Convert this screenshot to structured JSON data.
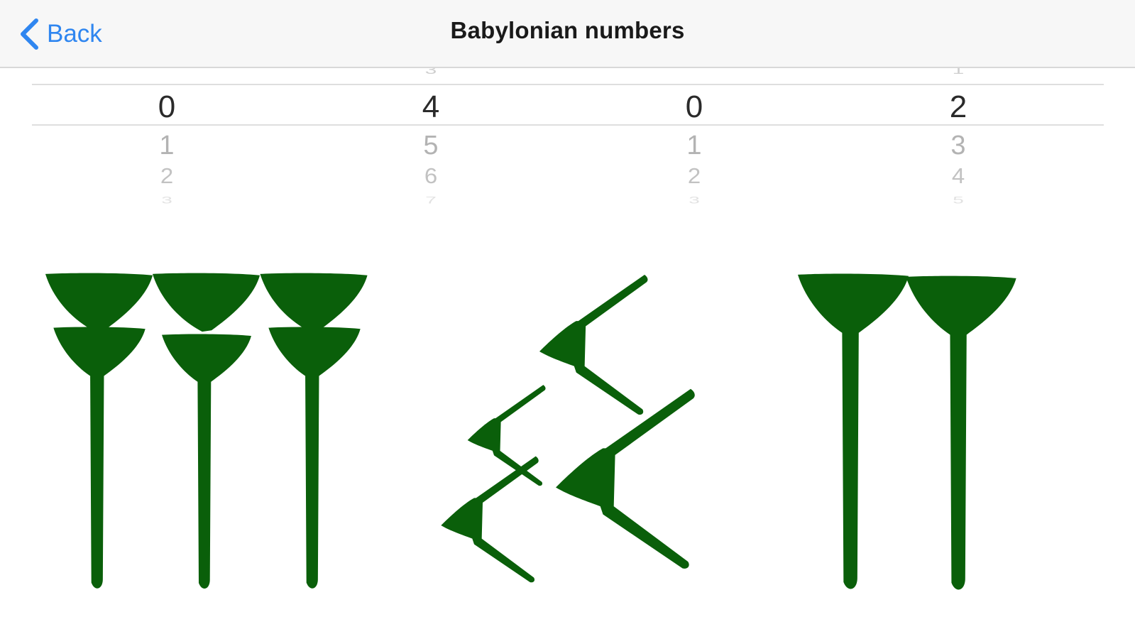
{
  "nav": {
    "back_label": "Back",
    "title": "Babylonian numbers"
  },
  "picker": {
    "columns": [
      {
        "prev": "",
        "selected": "0",
        "next1": "1",
        "next2": "2",
        "next3": "3"
      },
      {
        "prev": "3",
        "selected": "4",
        "next1": "5",
        "next2": "6",
        "next3": "7"
      },
      {
        "prev": "",
        "selected": "0",
        "next1": "1",
        "next2": "2",
        "next3": "3"
      },
      {
        "prev": "1",
        "selected": "2",
        "next1": "3",
        "next2": "4",
        "next3": "5"
      }
    ]
  },
  "cuneiform": {
    "groups": [
      "three-units-stacked",
      "four-tens",
      "two-units"
    ],
    "color": "#0a5f0a"
  },
  "colors": {
    "accent": "#2f86f0",
    "navbar_bg": "#f7f7f7",
    "glyph_green": "#0a5f0a"
  }
}
